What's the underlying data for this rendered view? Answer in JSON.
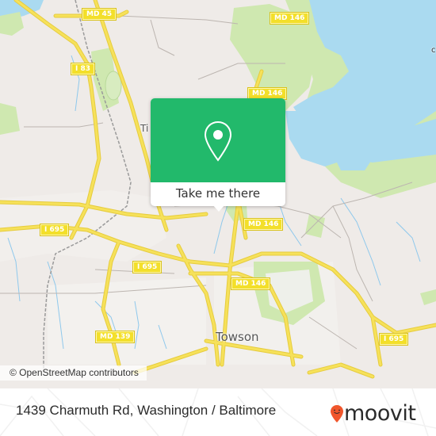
{
  "map": {
    "colors": {
      "land": "#efebe8",
      "water": "#aadaf0",
      "park": "#cfe8b0",
      "road_major": "#f6e15a",
      "stream": "#8ec8ec",
      "rail": "#9a9a9a"
    },
    "shields": [
      {
        "id": "md45",
        "label": "MD 45"
      },
      {
        "id": "i83",
        "label": "I 83"
      },
      {
        "id": "md146-top",
        "label": "MD 146"
      },
      {
        "id": "md146-mid",
        "label": "MD 146"
      },
      {
        "id": "md146-popup",
        "label": "MD 146"
      },
      {
        "id": "md146-lower",
        "label": "MD 146"
      },
      {
        "id": "i695-left",
        "label": "I 695"
      },
      {
        "id": "i695-center",
        "label": "I 695"
      },
      {
        "id": "i695-right",
        "label": "I 695"
      },
      {
        "id": "md139",
        "label": "MD 139"
      }
    ],
    "places": {
      "towson": "Towson",
      "timonium_partial": "Ti",
      "edge_partial": "c"
    },
    "attribution": "© OpenStreetMap contributors"
  },
  "popup": {
    "icon": "map-pin-icon",
    "button_label": "Take me there",
    "accent_color": "#22b96b"
  },
  "footer": {
    "address": "1439 Charmuth Rd, Washington / Baltimore",
    "logo_text": "moovit",
    "logo_icon": "moovit-pin-logo-icon",
    "logo_color": "#f0562c"
  }
}
